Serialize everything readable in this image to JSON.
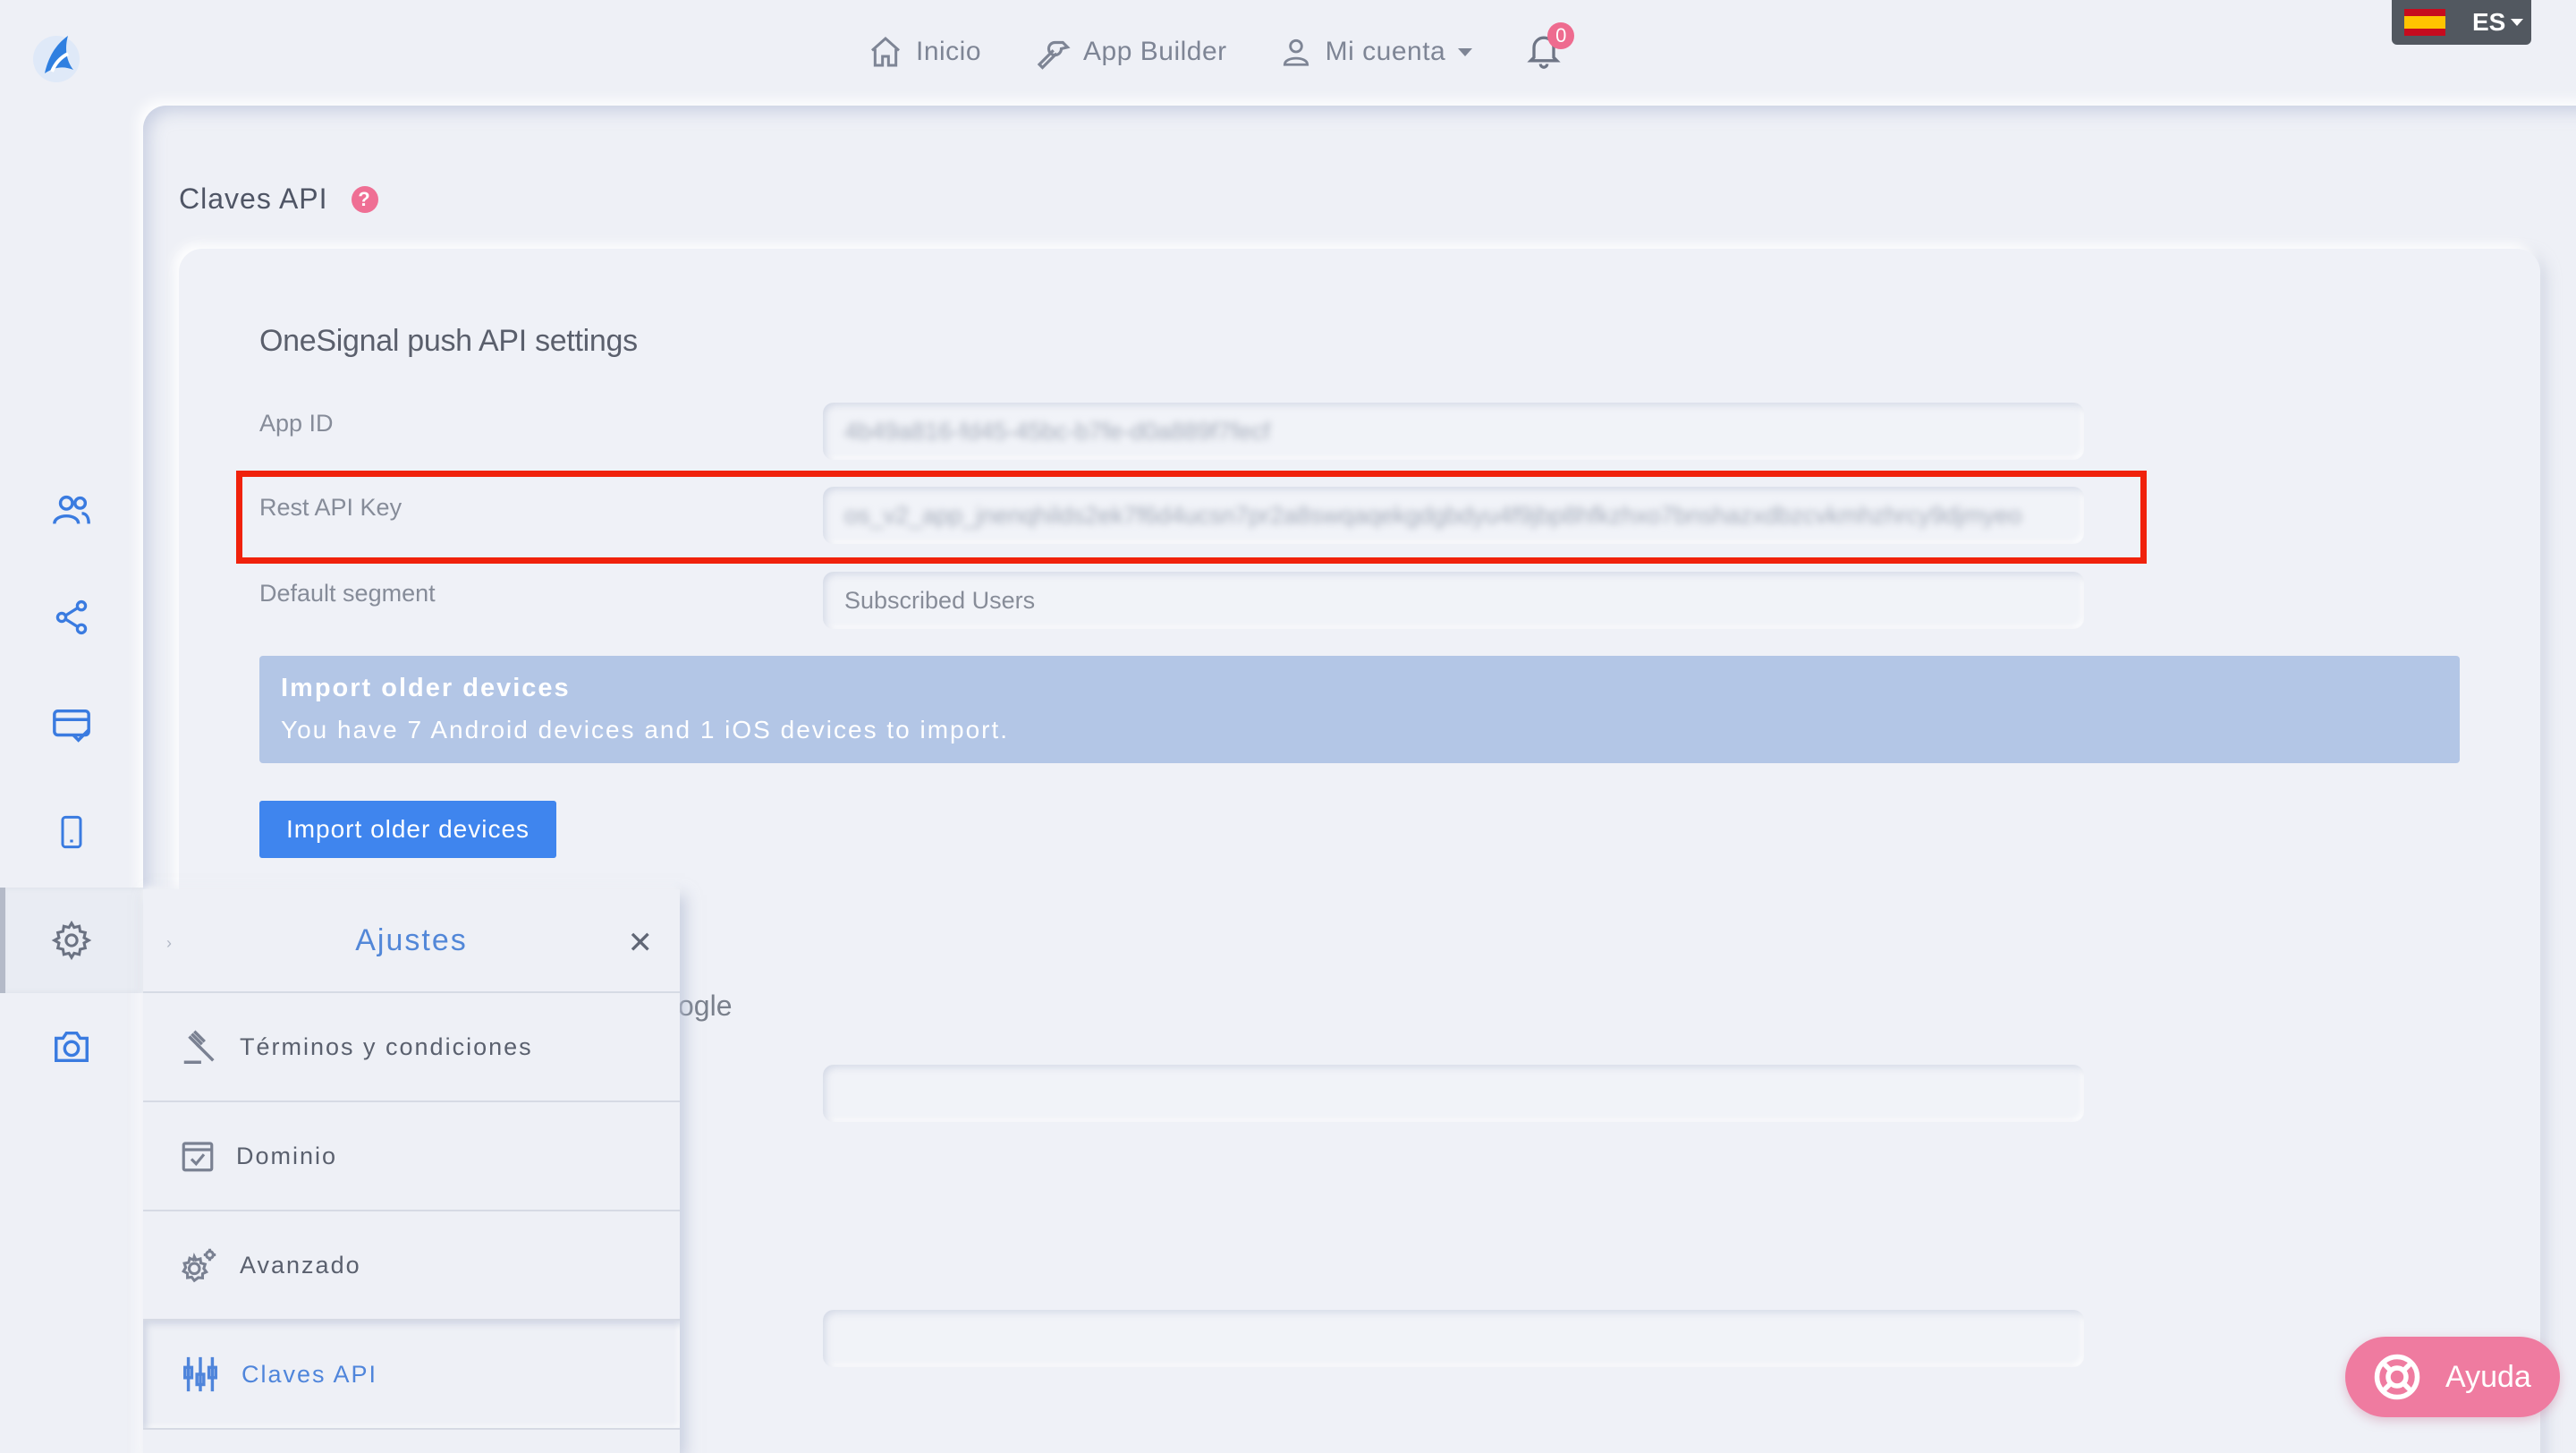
{
  "nav": {
    "home": "Inicio",
    "builder": "App Builder",
    "account": "Mi cuenta",
    "notifications_count": "0"
  },
  "lang": {
    "code": "ES"
  },
  "page": {
    "title": "Claves API",
    "help": "?"
  },
  "onesignal": {
    "section_title": "OneSignal push API settings",
    "app_id_label": "App ID",
    "app_id_value": "4b49a816-fd45-45bc-b7fe-d0a889f7fecf",
    "rest_key_label": "Rest API Key",
    "rest_key_value": "os_v2_app_jnenqhilds2ek7f6d4ucsn7pr2a8swqaqekgdgbdyu4f9jbp8hfkzhxo7bnshazxdbzcvkmhzhrcy9djmyeo",
    "segment_label": "Default segment",
    "segment_value": "Subscribed Users"
  },
  "alert": {
    "title": "Import older devices",
    "text": "You have 7 Android devices and 1 iOS devices to import."
  },
  "import_button": "Import older devices",
  "partial_text": "ogle",
  "settings_menu": {
    "title": "Ajustes",
    "items": [
      {
        "label": "Términos y condiciones",
        "icon": "gavel-icon"
      },
      {
        "label": "Dominio",
        "icon": "calendar-check-icon"
      },
      {
        "label": "Avanzado",
        "icon": "gears-icon"
      },
      {
        "label": "Claves API",
        "icon": "api-keys-icon"
      }
    ]
  },
  "help_button": "Ayuda",
  "colors": {
    "accent_blue": "#3f85ee",
    "highlight_red": "#f0220c",
    "pink": "#ef7ba0",
    "alert_bg": "#b3c6e6"
  }
}
